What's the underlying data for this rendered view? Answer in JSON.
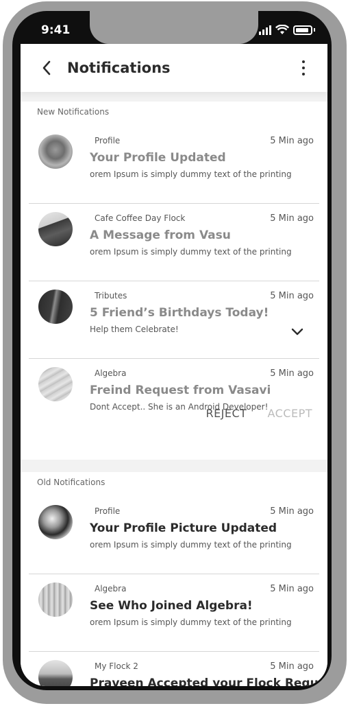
{
  "status_bar": {
    "time": "9:41",
    "icons": [
      "signal-icon",
      "wifi-icon",
      "battery-icon"
    ]
  },
  "header": {
    "title": "Notifications",
    "back_icon": "chevron-left-icon",
    "menu_icon": "more-vertical-icon"
  },
  "new_section": {
    "label": "New Notifications",
    "items": [
      {
        "group": "Profile",
        "time": "5 Min ago",
        "title": "Your Profile Updated",
        "body": "orem Ipsum is simply dummy text of the printing"
      },
      {
        "group": "Cafe Coffee Day Flock",
        "time": "5 Min ago",
        "title": "A Message from Vasu",
        "body": "orem Ipsum is simply dummy text of the printing"
      },
      {
        "group": "Tributes",
        "time": "5 Min ago",
        "title": "5 Friend’s Birthdays Today!",
        "body": "Help them Celebrate!"
      },
      {
        "group": "Algebra",
        "time": "5 Min ago",
        "title": "Freind Request from Vasavi",
        "body": "Dont Accept.. She is an Android Developer!"
      }
    ],
    "actions": {
      "reject": "REJECT",
      "accept": "ACCEPT"
    }
  },
  "old_section": {
    "label": "Old Notifications",
    "items": [
      {
        "group": "Profile",
        "time": "5 Min ago",
        "title": "Your Profile Picture Updated",
        "body": "orem Ipsum is simply dummy text of the printing"
      },
      {
        "group": "Algebra",
        "time": "5 Min ago",
        "title": "See Who Joined Algebra!",
        "body": "orem Ipsum is simply dummy text of the printing"
      },
      {
        "group": "My Flock 2",
        "time": "5 Min ago",
        "title": "Praveen Accepted your Flock Requ",
        "body": ""
      }
    ]
  }
}
